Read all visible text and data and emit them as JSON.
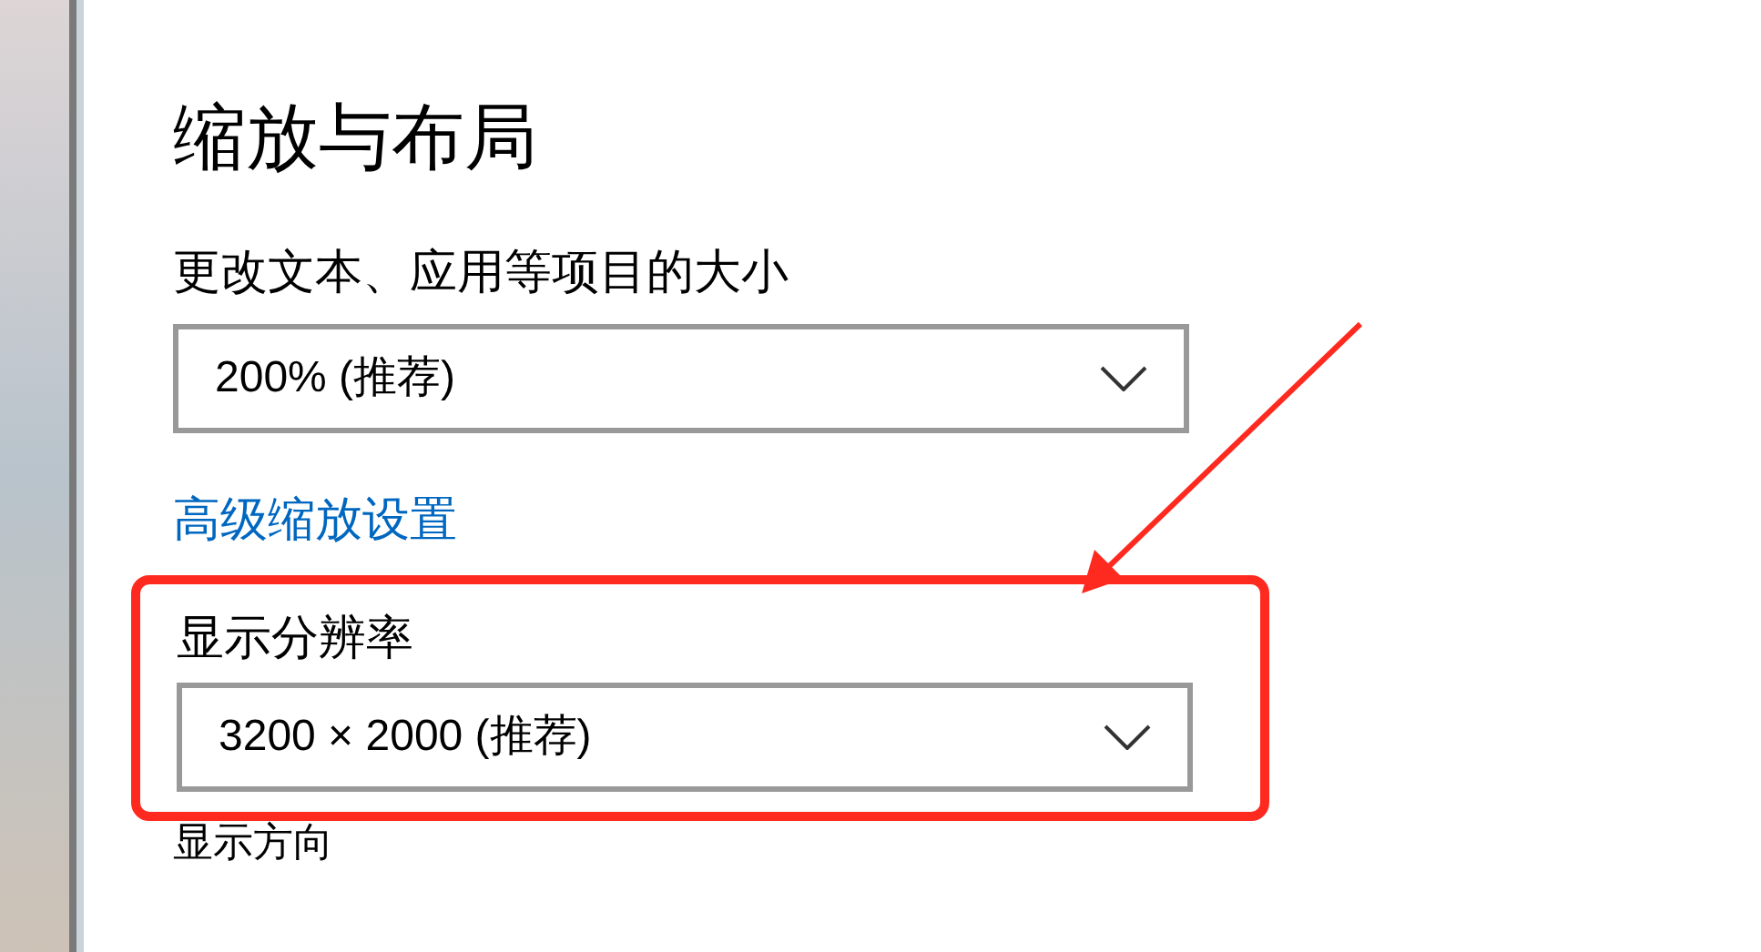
{
  "title": "缩放与布局",
  "scale": {
    "label": "更改文本、应用等项目的大小",
    "value": "200% (推荐)"
  },
  "advanced_link": "高级缩放设置",
  "resolution": {
    "label": "显示分辨率",
    "value": "3200 × 2000 (推荐)",
    "highlighted": true
  },
  "orientation_label": "显示方向"
}
